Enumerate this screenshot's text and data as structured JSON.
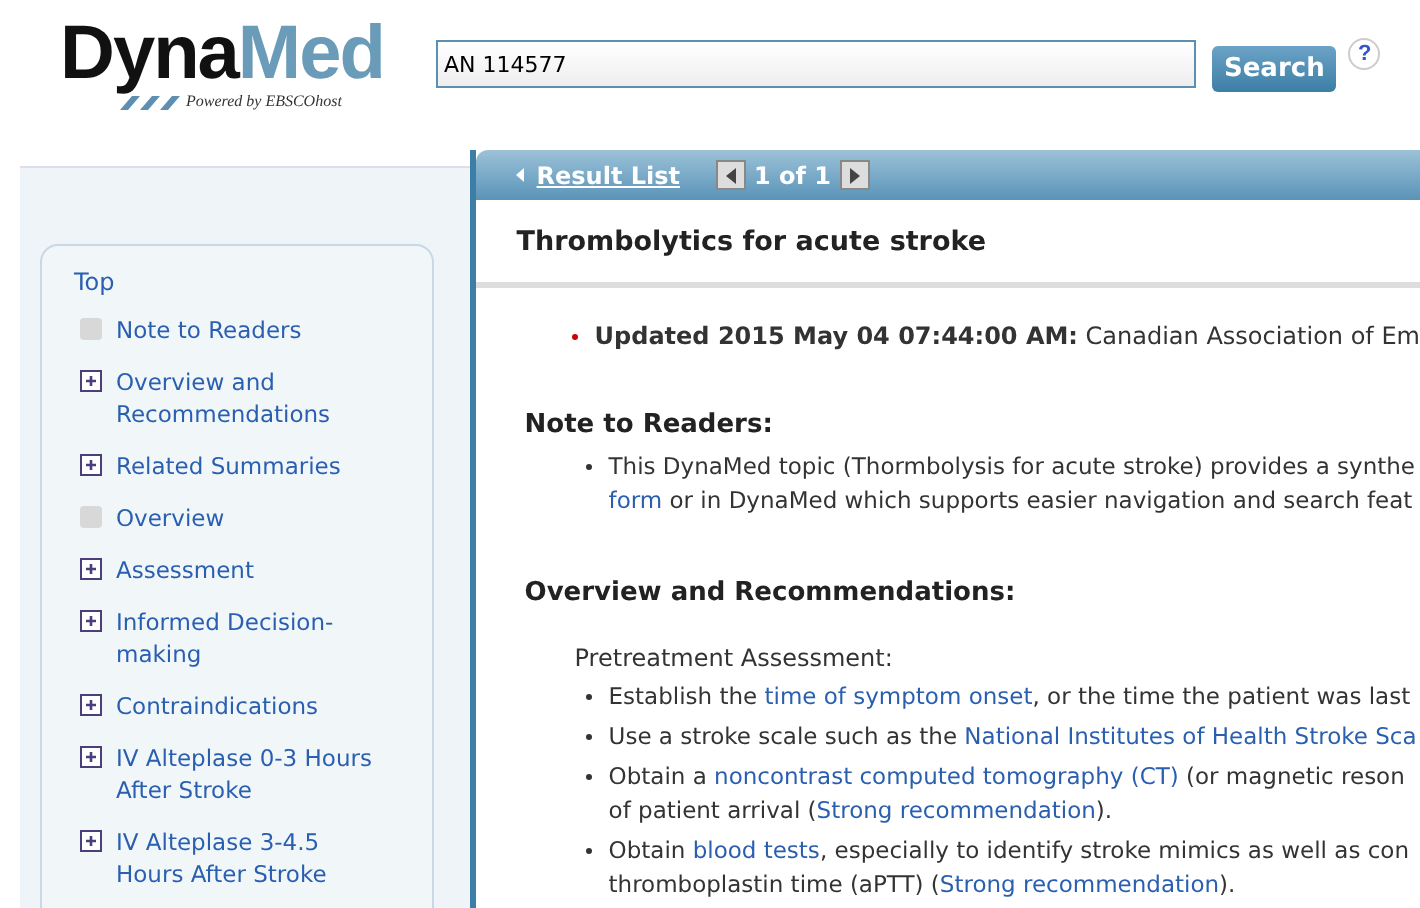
{
  "logo": {
    "part_1": "Dyna",
    "part_2": "Med",
    "tagline": "Powered by EBSCOhost"
  },
  "search": {
    "value": "AN 114577",
    "button": "Search",
    "help": "?"
  },
  "nav": {
    "back": "Result List",
    "pager": "1 of 1"
  },
  "outline": {
    "top": "Top",
    "items": [
      {
        "label": "Note to Readers",
        "kind": "leaf"
      },
      {
        "label": "Overview and Recommendations",
        "kind": "expandable"
      },
      {
        "label": "Related Summaries",
        "kind": "expandable"
      },
      {
        "label": "Overview",
        "kind": "leaf"
      },
      {
        "label": "Assessment",
        "kind": "expandable"
      },
      {
        "label": "Informed Decision-making",
        "kind": "expandable"
      },
      {
        "label": "Contraindications",
        "kind": "expandable"
      },
      {
        "label": "IV Alteplase 0-3 Hours After Stroke",
        "kind": "expandable"
      },
      {
        "label": "IV Alteplase 3-4.5 Hours After Stroke",
        "kind": "expandable"
      }
    ]
  },
  "article": {
    "title": "Thrombolytics for acute stroke",
    "update": {
      "label": "Updated 2015 May 04 07:44:00 AM:",
      "text": "Canadian Association of Em"
    },
    "sections": [
      {
        "heading": "Note to Readers:",
        "bullets": [
          [
            [
              {
                "text": "This DynaMed topic (Thormbolysis for acute stroke) provides a synthe",
                "link": false
              }
            ],
            [
              {
                "text": "form",
                "link": true
              },
              {
                "text": " or in DynaMed which supports easier navigation and search feat",
                "link": false
              }
            ]
          ]
        ]
      },
      {
        "heading": "Overview and Recommendations:",
        "subheading": "Pretreatment Assessment:",
        "bullets": [
          [
            [
              {
                "text": "Establish the ",
                "link": false
              },
              {
                "text": "time of symptom onset",
                "link": true
              },
              {
                "text": ", or the time the patient was last",
                "link": false
              }
            ]
          ],
          [
            [
              {
                "text": "Use a stroke scale such as the ",
                "link": false
              },
              {
                "text": "National Institutes of Health Stroke Sca",
                "link": true
              }
            ]
          ],
          [
            [
              {
                "text": "Obtain a ",
                "link": false
              },
              {
                "text": "noncontrast computed tomography (CT)",
                "link": true
              },
              {
                "text": " (or magnetic reson",
                "link": false
              }
            ],
            [
              {
                "text": "of patient arrival (",
                "link": false
              },
              {
                "text": "Strong recommendation",
                "link": true
              },
              {
                "text": ").",
                "link": false
              }
            ]
          ],
          [
            [
              {
                "text": "Obtain ",
                "link": false
              },
              {
                "text": "blood tests",
                "link": true
              },
              {
                "text": ", especially to identify stroke mimics as well as con",
                "link": false
              }
            ],
            [
              {
                "text": "thromboplastin time (aPTT) (",
                "link": false
              },
              {
                "text": "Strong recommendation",
                "link": true
              },
              {
                "text": ").",
                "link": false
              }
            ]
          ]
        ]
      }
    ]
  }
}
